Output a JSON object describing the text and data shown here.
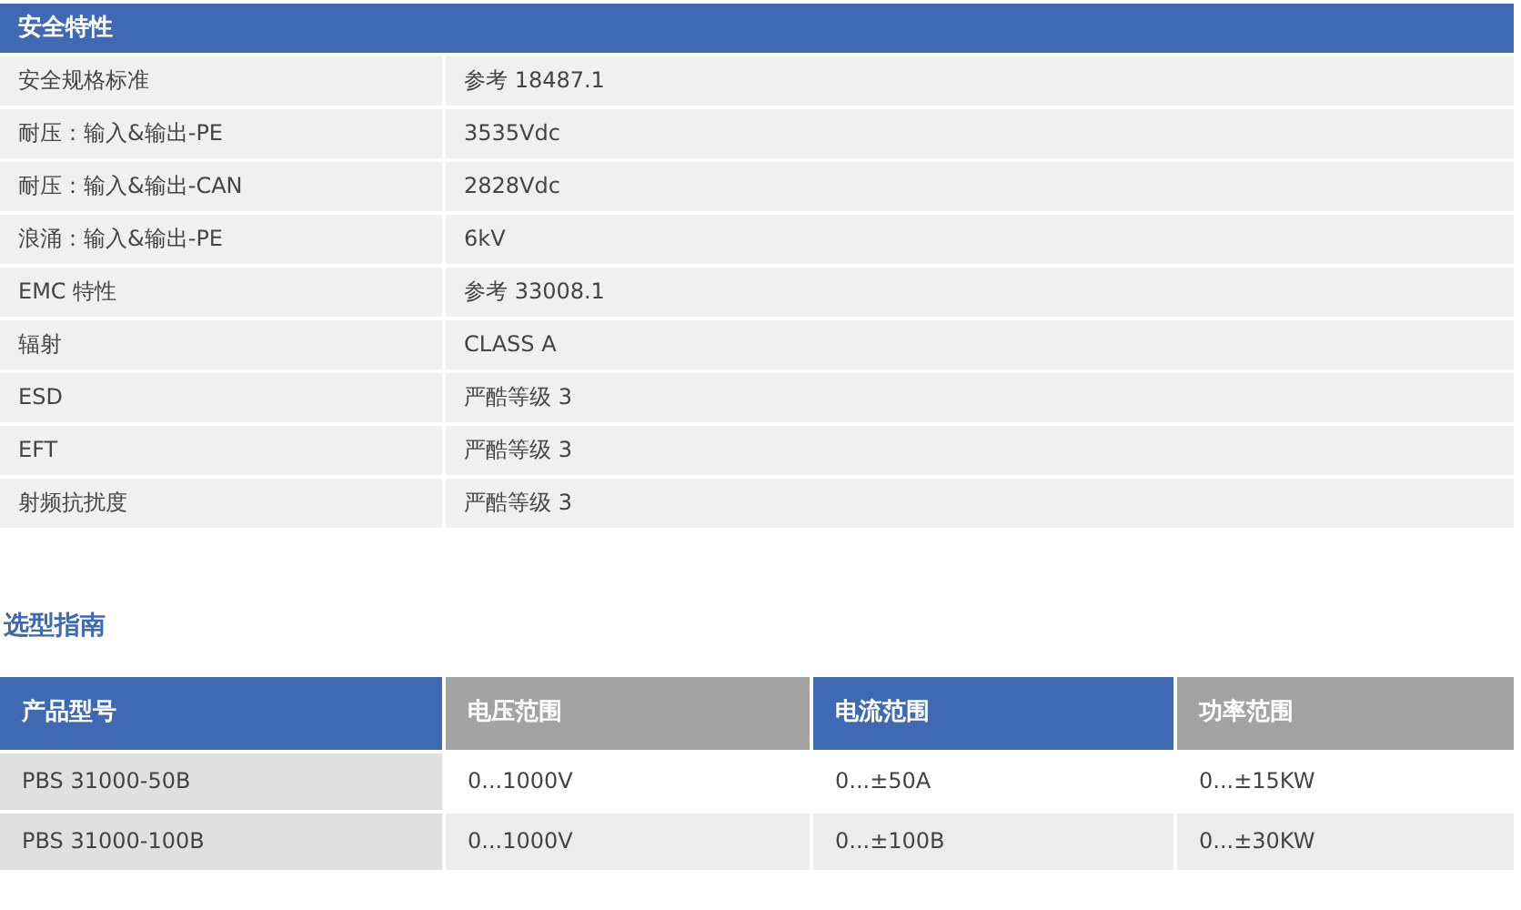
{
  "safety_table": {
    "title": "安全特性",
    "rows": [
      {
        "label": "安全规格标准",
        "value": "参考 18487.1"
      },
      {
        "label": "耐压：输入&输出-PE",
        "value": "3535Vdc"
      },
      {
        "label": "耐压：输入&输出-CAN",
        "value": "2828Vdc"
      },
      {
        "label": "浪涌：输入&输出-PE",
        "value": "6kV"
      },
      {
        "label": "EMC 特性",
        "value": "参考 33008.1"
      },
      {
        "label": "辐射",
        "value": "CLASS  A"
      },
      {
        "label": "ESD",
        "value": "严酷等级 3"
      },
      {
        "label": "EFT",
        "value": "严酷等级 3"
      },
      {
        "label": "射频抗扰度",
        "value": "严酷等级 3"
      }
    ]
  },
  "selection_heading": "选型指南",
  "selection_table": {
    "columns": [
      {
        "label": "产品型号",
        "color": "#3f69b2"
      },
      {
        "label": "电压范围",
        "color": "#a3a3a3"
      },
      {
        "label": "电流范围",
        "color": "#3f69b2"
      },
      {
        "label": "功率范围",
        "color": "#a3a3a3"
      }
    ],
    "rows": [
      [
        "PBS  31000-50B",
        "0...1000V",
        "0...±50A",
        "0...±15KW"
      ],
      [
        "PBS  31000-100B",
        "0...1000V",
        "0...±100B",
        "0...±30KW"
      ]
    ]
  }
}
